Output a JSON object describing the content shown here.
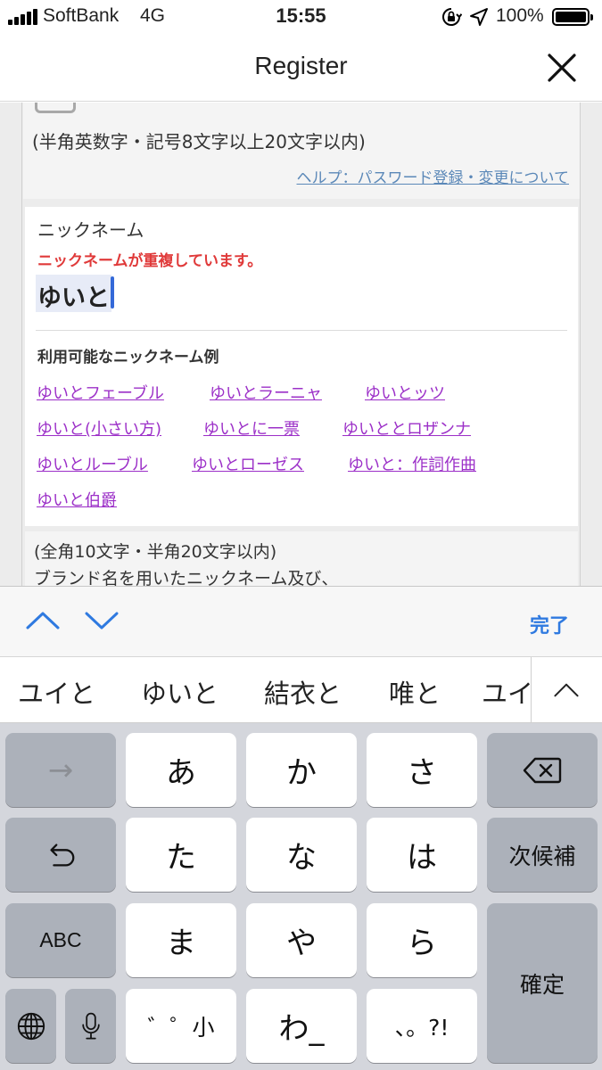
{
  "status_bar": {
    "carrier": "SoftBank",
    "network": "4G",
    "time": "15:55",
    "battery": "100%",
    "icons": [
      "signal-icon",
      "rotation-lock-icon",
      "location-icon",
      "battery-icon"
    ]
  },
  "nav": {
    "title": "Register",
    "close_icon": "close-icon"
  },
  "password_section": {
    "hint": "(半角英数字・記号8文字以上20文字以内)",
    "help_link": "ヘルプ：パスワード登録・変更について"
  },
  "nickname": {
    "label": "ニックネーム",
    "error": "ニックネームが重複しています。",
    "value": "ゆいと",
    "examples_title": "利用可能なニックネーム例",
    "examples": [
      "ゆいとフェーブル",
      "ゆいとラーニャ",
      "ゆいとッツ",
      "ゆいと(小さい方)",
      "ゆいとに一票",
      "ゆいととロザンナ",
      "ゆいとルーブル",
      "ゆいとローゼス",
      "ゆいと：作詞作曲",
      "ゆいと伯爵"
    ],
    "constraint": "(全角10文字・半角20文字以内)",
    "note": "ブランド名を用いたニックネーム及び、"
  },
  "accessory": {
    "prev_icon": "chevron-up-icon",
    "next_icon": "chevron-down-icon",
    "done": "完了"
  },
  "candidates": {
    "items": [
      "ユイと",
      "ゆいと",
      "結衣と",
      "唯と",
      "ユイ"
    ],
    "expand_icon": "chevron-up-icon"
  },
  "keyboard": {
    "row1": [
      "→",
      "あ",
      "か",
      "さ",
      "delete-icon"
    ],
    "row2": [
      "undo-icon",
      "た",
      "な",
      "は",
      "次候補"
    ],
    "row3": [
      "ABC",
      "ま",
      "や",
      "ら",
      "確定"
    ],
    "row4": [
      "globe-icon",
      "mic-icon",
      "゛゜小",
      "わ_",
      "、。?!"
    ],
    "colors": {
      "key": "#ffffff",
      "dark_key": "#acb1ba",
      "background": "#d4d6dc"
    }
  },
  "colors": {
    "error": "#e03a3a",
    "link": "#9c30c8",
    "help_link": "#5b88b8",
    "accent": "#2f7ae0",
    "caret": "#3469d8"
  }
}
